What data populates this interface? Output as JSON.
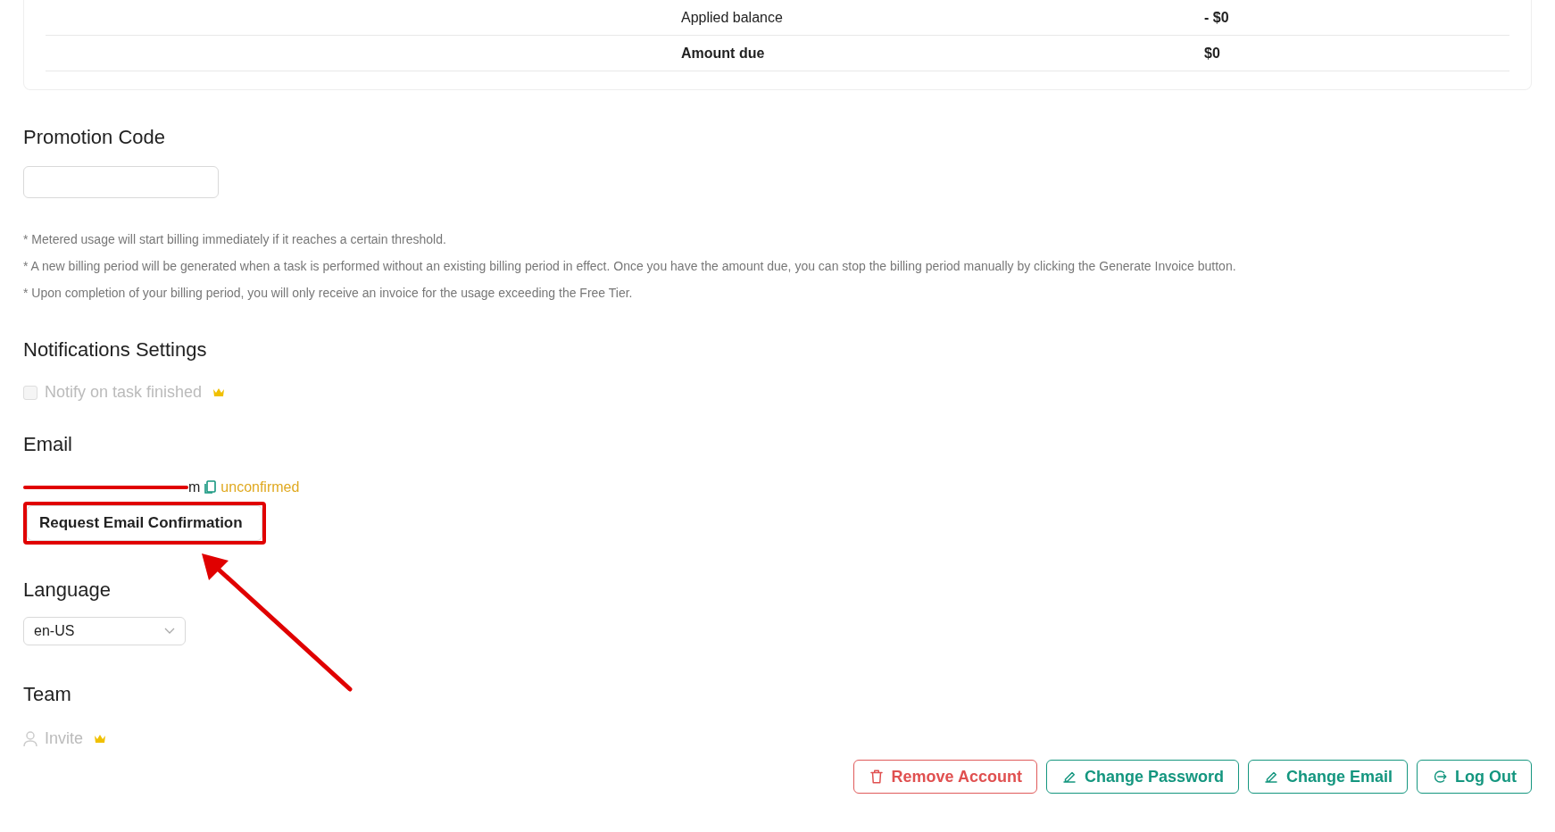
{
  "summary": {
    "rows": [
      {
        "label": "Applied balance",
        "value": "- $0",
        "bold": false
      },
      {
        "label": "Amount due",
        "value": "$0",
        "bold": true
      }
    ]
  },
  "promotion": {
    "title": "Promotion Code"
  },
  "notes": [
    "* Metered usage will start billing immediately if it reaches a certain threshold.",
    "* A new billing period will be generated when a task is performed without an existing billing period in effect. Once you have the amount due, you can stop the billing period manually by clicking the Generate Invoice button.",
    "* Upon completion of your billing period, you will only receive an invoice for the usage exceeding the Free Tier."
  ],
  "notifications": {
    "title": "Notifications Settings",
    "items": [
      {
        "label": "Notify on task finished",
        "checked": false,
        "disabled": true,
        "premium": true
      }
    ]
  },
  "email": {
    "title": "Email",
    "address": "m",
    "status": "unconfirmed",
    "button": "Request Email Confirmation"
  },
  "language": {
    "title": "Language",
    "value": "en-US"
  },
  "team": {
    "title": "Team",
    "invite": "Invite",
    "disabled": true,
    "premium": true
  },
  "actions": [
    {
      "label": "Remove Account",
      "kind": "remove"
    },
    {
      "label": "Change Password",
      "kind": "edit"
    },
    {
      "label": "Change Email",
      "kind": "edit"
    },
    {
      "label": "Log Out",
      "kind": "logout"
    }
  ],
  "annotations": [
    {
      "kind": "strike"
    },
    {
      "kind": "box"
    },
    {
      "kind": "arrow"
    }
  ]
}
